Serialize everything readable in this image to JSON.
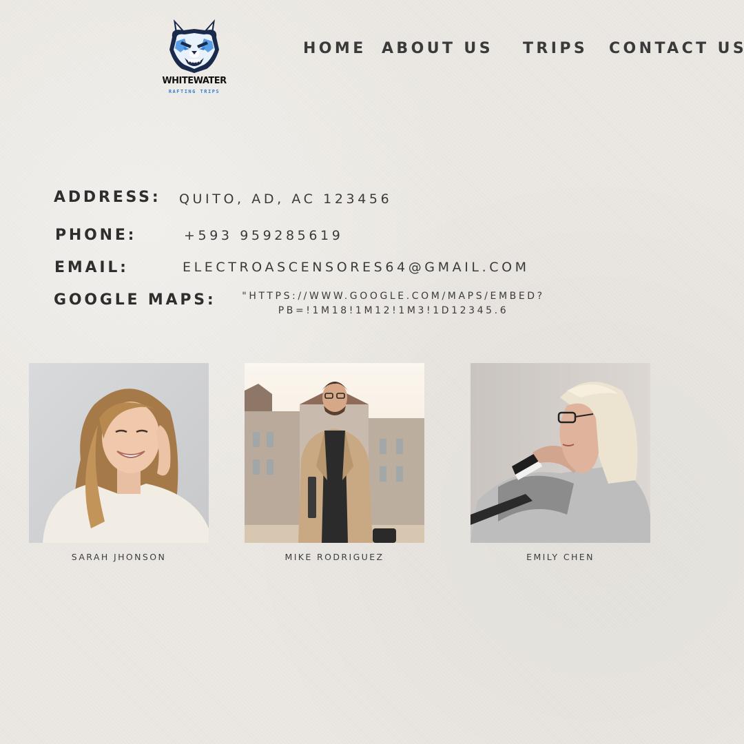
{
  "brand": {
    "title": "WHITEWATER",
    "subtitle": "RAFTING TRIPS",
    "logo_icon": "wolf-head-icon",
    "accent_color": "#2f7fd6"
  },
  "nav": {
    "items": [
      {
        "label": "HOME"
      },
      {
        "label": "ABOUT US"
      },
      {
        "label": "TRIPS"
      },
      {
        "label": "CONTACT US"
      }
    ]
  },
  "contact": {
    "address_label": "ADDRESS:",
    "address_value": "QUITO, AD, AC 123456",
    "phone_label": "PHONE:",
    "phone_value": "+593 959285619",
    "email_label": "EMAIL:",
    "email_value": "ELECTROASCENSORES64@GMAIL.COM",
    "maps_label": "GOOGLE MAPS:",
    "maps_value_line1": "\"HTTPS://WWW.GOOGLE.COM/MAPS/EMBED?",
    "maps_value_line2": "PB=!1M18!1M12!1M3!1D12345.6"
  },
  "team": [
    {
      "name": "SARAH JHONSON"
    },
    {
      "name": "MIKE RODRIGUEZ"
    },
    {
      "name": "EMILY CHEN"
    }
  ]
}
